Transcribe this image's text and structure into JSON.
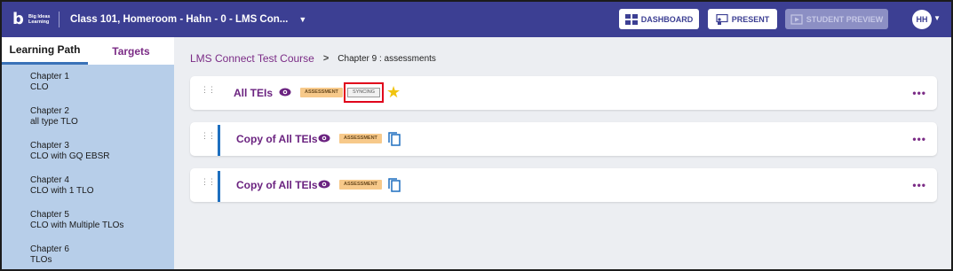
{
  "header": {
    "logo_text": "Big Ideas Learning",
    "class_title": "Class 101, Homeroom - Hahn - 0 - LMS Con...",
    "dashboard_label": "DASHBOARD",
    "present_label": "PRESENT",
    "student_preview_label": "STUDENT PREVIEW",
    "avatar_initials": "HH",
    "accent_color": "#3c3f93"
  },
  "sidebar": {
    "tabs": [
      {
        "label": "Learning Path",
        "active": true
      },
      {
        "label": "Targets",
        "active": false
      }
    ],
    "chapters": [
      {
        "title": "Chapter 1",
        "subtitle": "CLO"
      },
      {
        "title": "Chapter 2",
        "subtitle": "all type TLO"
      },
      {
        "title": "Chapter 3",
        "subtitle": "CLO with GQ EBSR"
      },
      {
        "title": "Chapter 4",
        "subtitle": "CLO with 1 TLO"
      },
      {
        "title": "Chapter 5",
        "subtitle": "CLO with Multiple TLOs"
      },
      {
        "title": "Chapter 6",
        "subtitle": "TLOs"
      }
    ]
  },
  "breadcrumb": {
    "course": "LMS Connect Test Course",
    "separator": ">",
    "current": "Chapter 9 : assessments"
  },
  "cards": [
    {
      "title": "All TEIs",
      "badge": "ASSESSMENT",
      "status": "SYNCING",
      "icon": "star-icon"
    },
    {
      "title": "Copy of All TEIs",
      "badge": "ASSESSMENT",
      "icon": "copy-icon"
    },
    {
      "title": "Copy of All TEIs",
      "badge": "ASSESSMENT",
      "icon": "copy-icon"
    }
  ]
}
